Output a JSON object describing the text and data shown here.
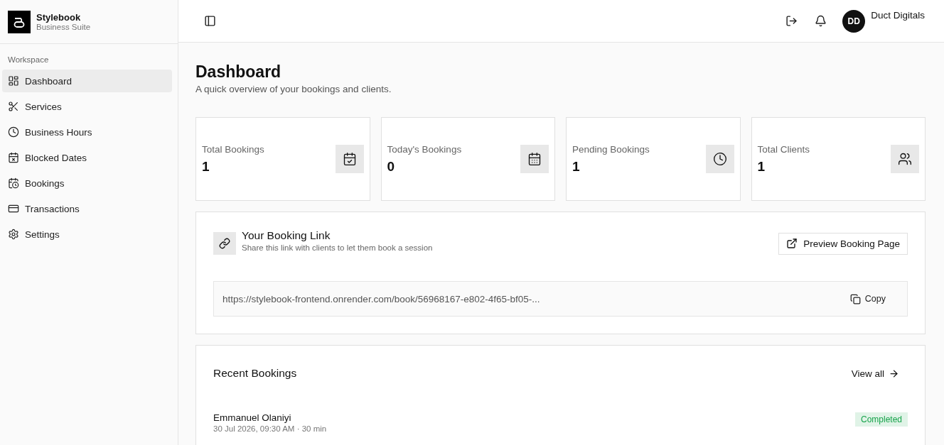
{
  "brand": {
    "name": "Stylebook",
    "subtitle": "Business Suite"
  },
  "sidebar": {
    "section": "Workspace",
    "items": [
      {
        "label": "Dashboard",
        "selected": true
      },
      {
        "label": "Services",
        "selected": false
      },
      {
        "label": "Business Hours",
        "selected": false
      },
      {
        "label": "Blocked Dates",
        "selected": false
      },
      {
        "label": "Bookings",
        "selected": false
      },
      {
        "label": "Transactions",
        "selected": false
      },
      {
        "label": "Settings",
        "selected": false
      }
    ]
  },
  "header": {
    "avatar": "DD",
    "user": "Duct Digitals"
  },
  "page": {
    "title": "Dashboard",
    "subtitle": "A quick overview of your bookings and clients."
  },
  "stats": [
    {
      "label": "Total Bookings",
      "value": "1"
    },
    {
      "label": "Today's Bookings",
      "value": "0"
    },
    {
      "label": "Pending Bookings",
      "value": "1"
    },
    {
      "label": "Total Clients",
      "value": "1"
    }
  ],
  "booking_link": {
    "title": "Your Booking Link",
    "subtitle": "Share this link with clients to let them book a session",
    "preview_button": "Preview Booking Page",
    "url": "https://stylebook-frontend.onrender.com/book/56968167-e802-4f65-bf05-...",
    "copy_button": "Copy"
  },
  "recent": {
    "title": "Recent Bookings",
    "view_all": "View all",
    "rows": [
      {
        "client": "Emmanuel Olaniyi",
        "details": "30 Jul 2026, 09:30 AM · 30 min",
        "status": "Completed",
        "color": "#16a34a"
      }
    ]
  }
}
